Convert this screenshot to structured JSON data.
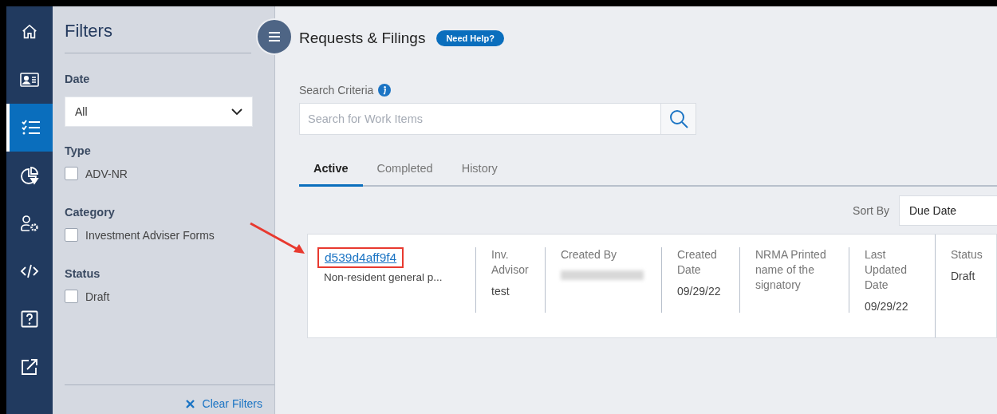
{
  "nav": [
    {
      "kind": "home",
      "selected": false
    },
    {
      "kind": "profile",
      "selected": false
    },
    {
      "kind": "tasks",
      "selected": true
    },
    {
      "kind": "reports",
      "selected": false
    },
    {
      "kind": "users",
      "selected": false
    },
    {
      "kind": "code",
      "selected": false
    },
    {
      "kind": "help",
      "selected": false
    },
    {
      "kind": "external",
      "selected": false
    }
  ],
  "filters": {
    "title": "Filters",
    "date": {
      "label": "Date",
      "value": "All"
    },
    "groups": [
      {
        "label": "Type",
        "options": [
          {
            "label": "ADV-NR",
            "checked": false
          }
        ]
      },
      {
        "label": "Category",
        "options": [
          {
            "label": "Investment Adviser Forms",
            "checked": false
          }
        ]
      },
      {
        "label": "Status",
        "options": [
          {
            "label": "Draft",
            "checked": false
          }
        ]
      }
    ],
    "clear": "Clear Filters"
  },
  "main": {
    "title": "Requests & Filings",
    "help_button": "Need Help?",
    "search": {
      "label": "Search Criteria",
      "placeholder": "Search for Work Items"
    },
    "tabs": [
      {
        "label": "Active",
        "selected": true
      },
      {
        "label": "Completed",
        "selected": false
      },
      {
        "label": "History",
        "selected": false
      }
    ],
    "sort": {
      "label": "Sort By",
      "value": "Due Date"
    },
    "rows": [
      {
        "id": "d539d4aff9f4",
        "description": "Non-resident general p...",
        "highlighted": true,
        "cells": [
          {
            "header": "Inv. Advisor",
            "value": "test"
          },
          {
            "header": "Created By",
            "redacted": true
          },
          {
            "header": "Created Date",
            "value": "09/29/22"
          },
          {
            "header": "NRMA Printed name of the signatory"
          },
          {
            "header": "Last Updated Date",
            "value": "09/29/22"
          },
          {
            "header": "Status",
            "value": "Draft"
          }
        ]
      }
    ]
  }
}
